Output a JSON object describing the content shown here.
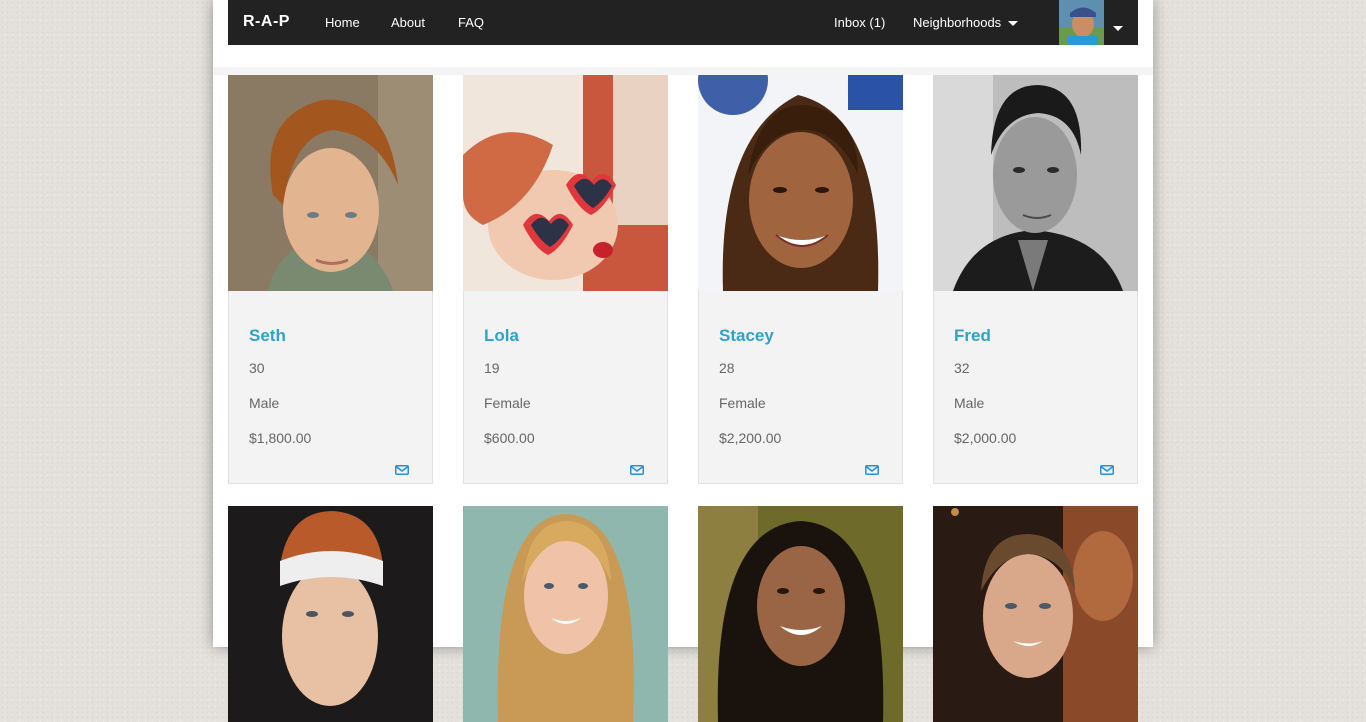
{
  "navbar": {
    "brand": "R-A-P",
    "links": [
      "Home",
      "About",
      "FAQ"
    ],
    "inbox": "Inbox (1)",
    "neighborhoods": "Neighborhoods"
  },
  "colors": {
    "navbar": "#222222",
    "accent": "#2ea3c9",
    "card": "#f3f3f3",
    "page_background": "#e4e1dc"
  },
  "icons": {
    "mail": "envelope-icon",
    "dropdown": "caret-down-icon"
  },
  "profiles": [
    {
      "name": "Seth",
      "age": "30",
      "gender": "Male",
      "price": "$1,800.00"
    },
    {
      "name": "Lola",
      "age": "19",
      "gender": "Female",
      "price": "$600.00"
    },
    {
      "name": "Stacey",
      "age": "28",
      "gender": "Female",
      "price": "$2,200.00"
    },
    {
      "name": "Fred",
      "age": "32",
      "gender": "Male",
      "price": "$2,000.00"
    },
    {
      "name": "",
      "age": "",
      "gender": "",
      "price": ""
    },
    {
      "name": "",
      "age": "",
      "gender": "",
      "price": ""
    },
    {
      "name": "",
      "age": "",
      "gender": "",
      "price": ""
    },
    {
      "name": "",
      "age": "",
      "gender": "",
      "price": ""
    }
  ]
}
